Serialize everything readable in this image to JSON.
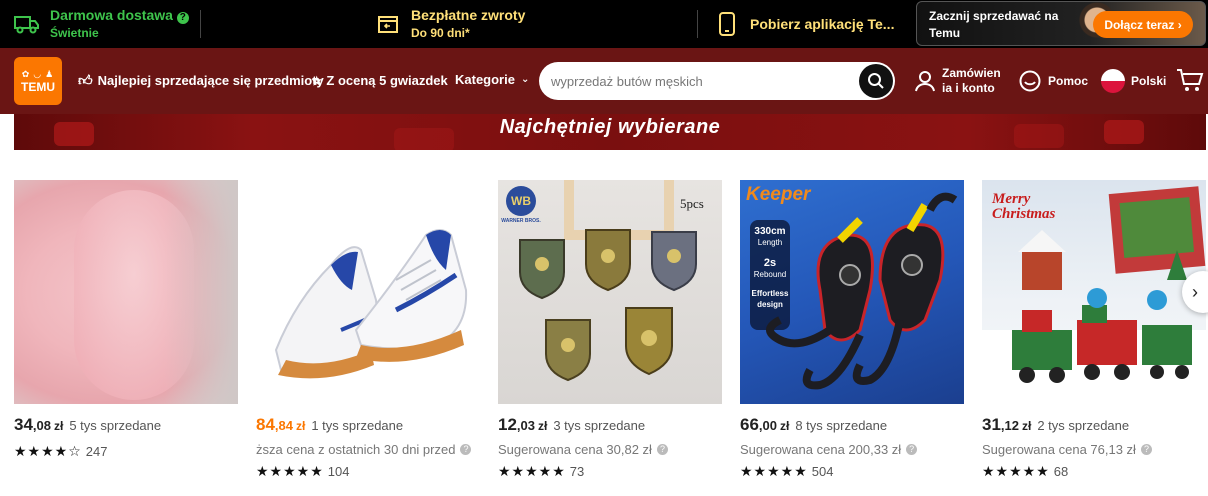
{
  "promo": {
    "shipping_title": "Darmowa dostawa",
    "shipping_sub": "Świetnie",
    "returns_title": "Bezpłatne zwroty",
    "returns_sub": "Do 90 dni*",
    "app_title": "Pobierz aplikację Te...",
    "seller_text_line1": "Zacznij sprzedawać na",
    "seller_text_line2": "Temu",
    "seller_button": "Dołącz teraz"
  },
  "nav": {
    "logo_text": "TEMU",
    "bestsellers": "Najlepiej sprzedające się przedmioty",
    "five_stars": "Z oceną 5 gwiazdek",
    "categories": "Kategorie",
    "search_placeholder": "wyprzedaż butów męskich",
    "orders_line1": "Zamówien",
    "orders_line2": "ia i konto",
    "help": "Pomoc",
    "language": "Polski"
  },
  "banner": {
    "title": "Najchętniej wybierane"
  },
  "products": [
    {
      "price_int": "34",
      "price_dec": ",08",
      "currency": "zł",
      "sold": "5 tys sprzedane",
      "suggested": "",
      "stars": "★★★★☆",
      "reviews": "247",
      "highlight": false
    },
    {
      "price_int": "84",
      "price_dec": ",84",
      "currency": "zł",
      "sold": "1 tys sprzedane",
      "suggested": "ższa cena z ostatnich 30 dni przed",
      "stars": "★★★★★",
      "reviews": "104",
      "highlight": true
    },
    {
      "price_int": "12",
      "price_dec": ",03",
      "currency": "zł",
      "sold": "3 tys sprzedane",
      "suggested": "Sugerowana cena 30,82 zł",
      "stars": "★★★★★",
      "reviews": "73",
      "highlight": false
    },
    {
      "price_int": "66",
      "price_dec": ",00",
      "currency": "zł",
      "sold": "8 tys sprzedane",
      "suggested": "Sugerowana cena 200,33 zł",
      "stars": "★★★★★",
      "reviews": "504",
      "highlight": false
    },
    {
      "price_int": "31",
      "price_dec": ",12",
      "currency": "zł",
      "sold": "2 tys sprzedane",
      "suggested": "Sugerowana cena 76,13 zł",
      "stars": "★★★★★",
      "reviews": "68",
      "highlight": false
    }
  ],
  "image_text": {
    "p3_brand": "WB",
    "p3_brand_sub": "WARNER BROS.",
    "p3_count": "5pcs",
    "p4_brand": "Keeper",
    "p4_len": "330cm",
    "p4_len_label": "Length",
    "p4_rebound": "2s",
    "p4_rebound_label": "Rebound",
    "p4_design1": "Effortless",
    "p4_design2": "design",
    "p5_text1": "Merry",
    "p5_text2": "Christmas"
  },
  "colors": {
    "accent": "#fb7701",
    "nav_bg": "#6a1514",
    "promo_green": "#3ec44c",
    "promo_yellow": "#ffe079"
  }
}
